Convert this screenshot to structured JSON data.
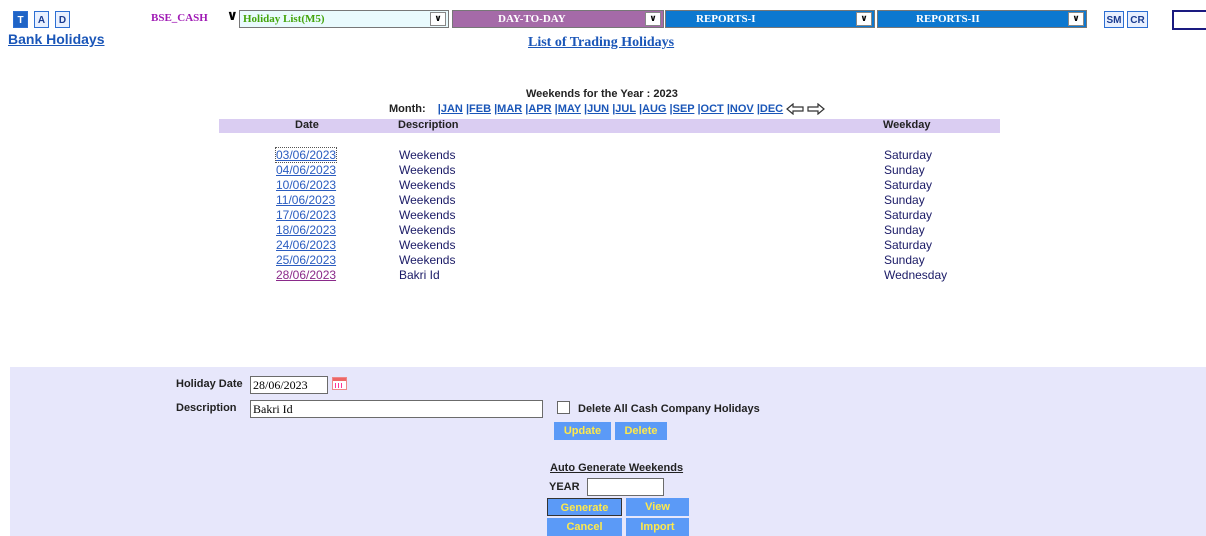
{
  "toolbar": {
    "mode_buttons": [
      "T",
      "A",
      "D"
    ],
    "exchange_select": "BSE_CASH",
    "module_select": "Holiday List(M5)",
    "menu_day": "DAY-TO-DAY",
    "menu_reports1": "REPORTS-I",
    "menu_reports2": "REPORTS-II",
    "sm_button": "SM",
    "cr_button": "CR"
  },
  "bank_holidays_link": "Bank Holidays",
  "page_title": "List of Trading Holidays",
  "weekends_heading": "Weekends for the Year : 2023",
  "month_nav": {
    "label": "Month:",
    "months": [
      "|JAN",
      "|FEB",
      "|MAR",
      "|APR",
      "|MAY",
      "|JUN",
      "|JUL",
      "|AUG",
      "|SEP",
      "|OCT",
      "|NOV",
      "|DEC"
    ]
  },
  "table": {
    "headers": [
      "Date",
      "Description",
      "Weekday"
    ],
    "rows": [
      {
        "date": "03/06/2023",
        "description": "Weekends",
        "weekday": "Saturday"
      },
      {
        "date": "04/06/2023",
        "description": "Weekends",
        "weekday": "Sunday"
      },
      {
        "date": "10/06/2023",
        "description": "Weekends",
        "weekday": "Saturday"
      },
      {
        "date": "11/06/2023",
        "description": "Weekends",
        "weekday": "Sunday"
      },
      {
        "date": "17/06/2023",
        "description": "Weekends",
        "weekday": "Saturday"
      },
      {
        "date": "18/06/2023",
        "description": "Weekends",
        "weekday": "Sunday"
      },
      {
        "date": "24/06/2023",
        "description": "Weekends",
        "weekday": "Saturday"
      },
      {
        "date": "25/06/2023",
        "description": "Weekends",
        "weekday": "Sunday"
      },
      {
        "date": "28/06/2023",
        "description": "Bakri Id",
        "weekday": "Wednesday"
      }
    ]
  },
  "form": {
    "holiday_date_label": "Holiday Date",
    "holiday_date_value": "28/06/2023",
    "description_label": "Description",
    "description_value": "Bakri Id",
    "delete_all_label": "Delete All Cash Company Holidays",
    "update_button": "Update",
    "delete_button": "Delete",
    "auto_generate_heading": "Auto Generate Weekends",
    "year_label": "YEAR",
    "year_value": "",
    "generate_button": "Generate",
    "view_button": "View",
    "cancel_button": "Cancel",
    "import_button": "Import"
  },
  "colors": {
    "panel_bg": "#e7e7fb",
    "table_header_bg": "#dacdf2",
    "button_bg": "#5b9af7",
    "button_text": "#ffe94a",
    "menu_purple": "#a56aa8",
    "menu_blue": "#0c78d0"
  }
}
